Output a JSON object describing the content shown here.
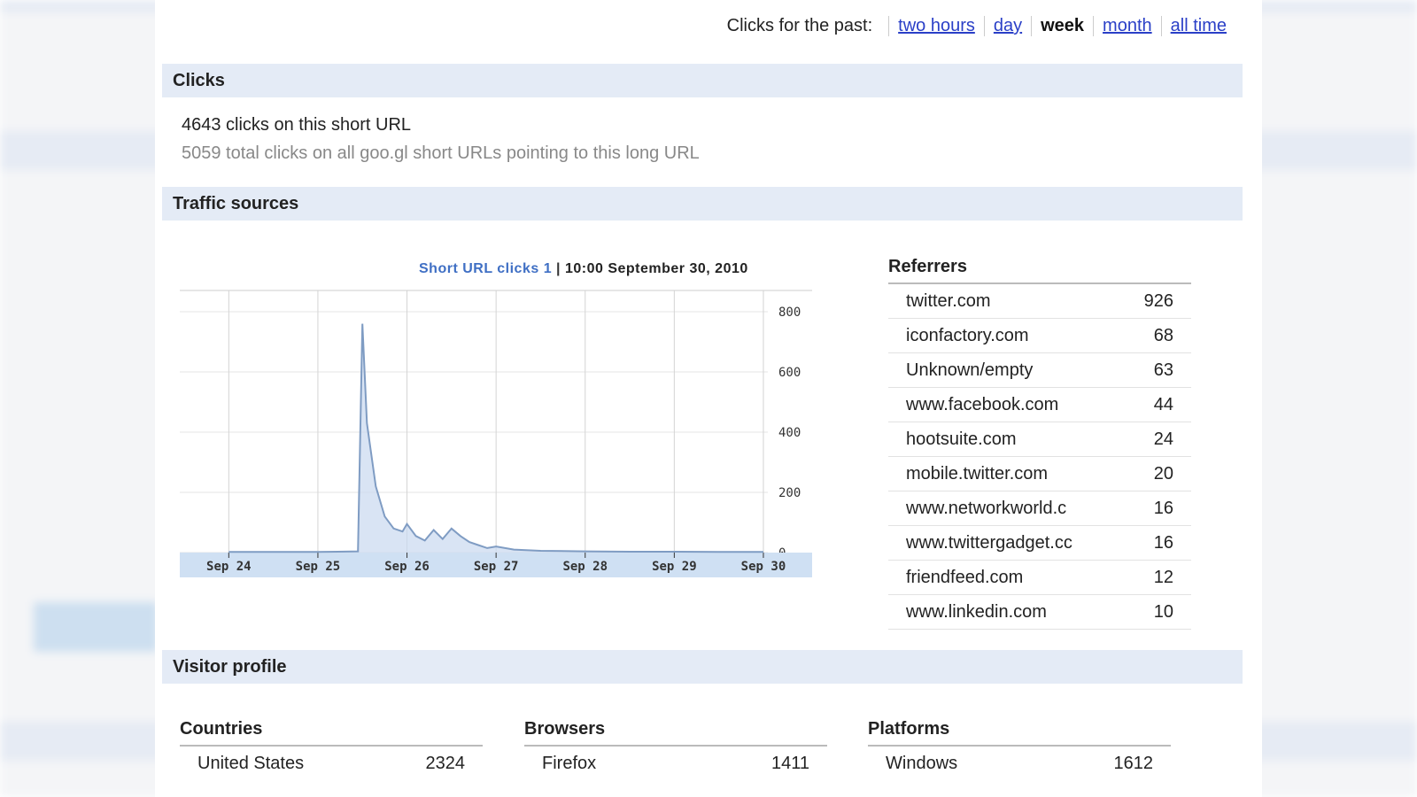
{
  "period": {
    "label": "Clicks for the past:",
    "options": [
      "two hours",
      "day",
      "week",
      "month",
      "all time"
    ],
    "active": "week"
  },
  "sections": {
    "clicks": "Clicks",
    "traffic": "Traffic sources",
    "visitor": "Visitor profile"
  },
  "clicks": {
    "short_url": "4643 clicks on this short URL",
    "total": "5059 total clicks on all goo.gl short URLs pointing to this long URL"
  },
  "chart_data": {
    "type": "area",
    "series_label": "Short URL clicks 1",
    "date_label": "10:00 September 30, 2010",
    "x_ticks": [
      "Sep 24",
      "Sep 25",
      "Sep 26",
      "Sep 27",
      "Sep 28",
      "Sep 29",
      "Sep 30"
    ],
    "y_ticks": [
      "800",
      "600",
      "400",
      "200",
      "0"
    ],
    "ylim": [
      0,
      800
    ],
    "points": [
      [
        0,
        2
      ],
      [
        1.0,
        2
      ],
      [
        1.45,
        4
      ],
      [
        1.5,
        760
      ],
      [
        1.55,
        430
      ],
      [
        1.65,
        220
      ],
      [
        1.75,
        120
      ],
      [
        1.85,
        80
      ],
      [
        1.95,
        70
      ],
      [
        2.0,
        95
      ],
      [
        2.1,
        55
      ],
      [
        2.2,
        40
      ],
      [
        2.3,
        75
      ],
      [
        2.4,
        45
      ],
      [
        2.5,
        80
      ],
      [
        2.6,
        55
      ],
      [
        2.7,
        35
      ],
      [
        2.8,
        25
      ],
      [
        2.9,
        15
      ],
      [
        3.0,
        20
      ],
      [
        3.2,
        10
      ],
      [
        3.5,
        6
      ],
      [
        4.0,
        4
      ],
      [
        4.5,
        3
      ],
      [
        5.0,
        3
      ],
      [
        5.5,
        2
      ],
      [
        6.0,
        2
      ]
    ],
    "grid": true,
    "colors": {
      "line": "#7f9cc3",
      "fill": "#c9d9ef",
      "axis_band": "#cfe0f3",
      "title_series": "#3f6fc4"
    }
  },
  "referrers": {
    "title": "Referrers",
    "rows": [
      {
        "name": "twitter.com",
        "count": "926"
      },
      {
        "name": "iconfactory.com",
        "count": "68"
      },
      {
        "name": "Unknown/empty",
        "count": "63"
      },
      {
        "name": "www.facebook.com",
        "count": "44"
      },
      {
        "name": "hootsuite.com",
        "count": "24"
      },
      {
        "name": "mobile.twitter.com",
        "count": "20"
      },
      {
        "name": "www.networkworld.c",
        "count": "16"
      },
      {
        "name": "www.twittergadget.cc",
        "count": "16"
      },
      {
        "name": "friendfeed.com",
        "count": "12"
      },
      {
        "name": "www.linkedin.com",
        "count": "10"
      }
    ]
  },
  "profile": {
    "countries": {
      "title": "Countries",
      "name": "United States",
      "count": "2324"
    },
    "browsers": {
      "title": "Browsers",
      "name": "Firefox",
      "count": "1411"
    },
    "platforms": {
      "title": "Platforms",
      "name": "Windows",
      "count": "1612"
    }
  }
}
